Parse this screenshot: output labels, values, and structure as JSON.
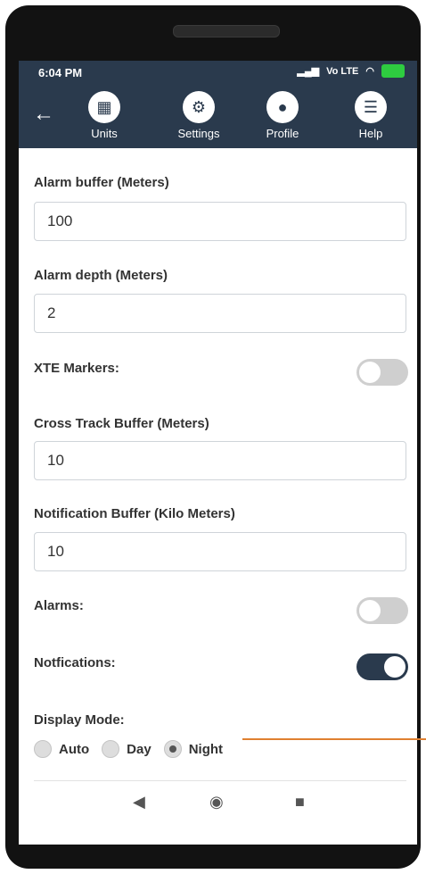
{
  "status": {
    "time": "6:04 PM",
    "network": "Vo LTE",
    "signal": "signal-icon",
    "wifi": "wifi-icon",
    "battery": "battery-charging-icon"
  },
  "nav": {
    "back_icon": "back-arrow-icon",
    "tabs": [
      {
        "label": "Units",
        "icon": "units-icon"
      },
      {
        "label": "Settings",
        "icon": "gear-icon"
      },
      {
        "label": "Profile",
        "icon": "person-icon"
      },
      {
        "label": "Help",
        "icon": "list-icon"
      }
    ],
    "active_tab": "Settings"
  },
  "settings": {
    "alarm_buffer_label": "Alarm buffer (Meters)",
    "alarm_buffer_value": "100",
    "alarm_depth_label": "Alarm depth (Meters)",
    "alarm_depth_value": "2",
    "xte_label": "XTE Markers:",
    "xte_on": false,
    "cross_track_label": "Cross Track Buffer (Meters)",
    "cross_track_value": "10",
    "notification_buffer_label": "Notification Buffer (Kilo Meters)",
    "notification_buffer_value": "10",
    "alarms_label": "Alarms:",
    "alarms_on": false,
    "notifications_label": "Notfications:",
    "notifications_on": true,
    "display_mode_label": "Display Mode:",
    "display_modes": [
      "Auto",
      "Day",
      "Night"
    ],
    "display_mode_selected": "Night"
  },
  "system_nav": {
    "back": "◀",
    "home": "◉",
    "recents": "■"
  },
  "colors": {
    "header": "#2a3a4d",
    "accent": "#2a3a4d",
    "annotation_line": "#e08030"
  }
}
